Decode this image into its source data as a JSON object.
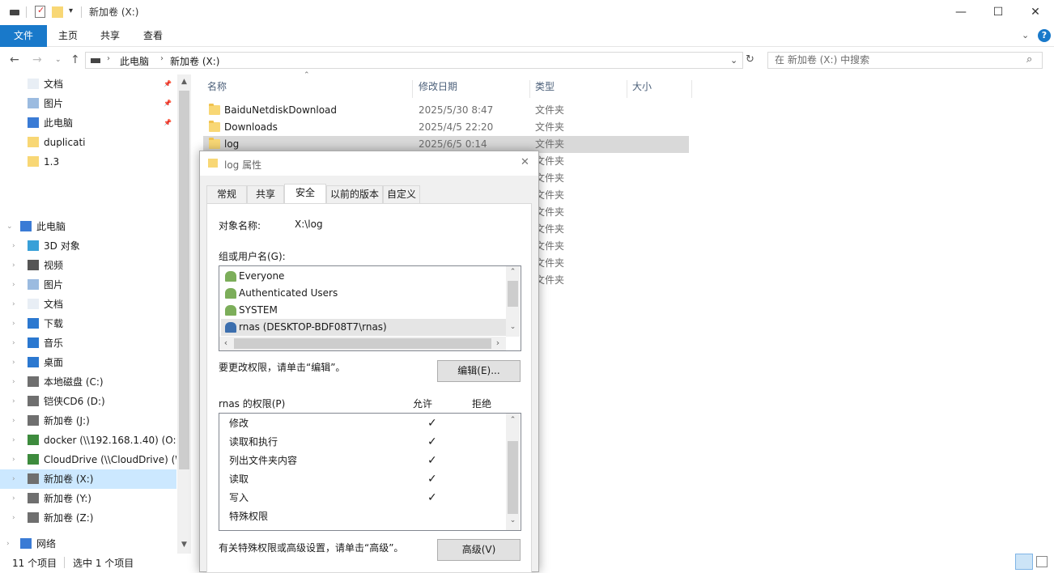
{
  "window": {
    "title": "新加卷 (X:)",
    "minimize": "—",
    "maximize": "☐",
    "close": "✕"
  },
  "ribbon": {
    "tabs": [
      "文件",
      "主页",
      "共享",
      "查看"
    ],
    "help": "?"
  },
  "address": {
    "crumbs": [
      "此电脑",
      "新加卷 (X:)"
    ],
    "search_placeholder": "在 新加卷 (X:) 中搜索"
  },
  "nav": {
    "quick": [
      {
        "label": "文档",
        "icon": "document-icon",
        "pinned": true
      },
      {
        "label": "图片",
        "icon": "picture-icon",
        "pinned": true
      },
      {
        "label": "此电脑",
        "icon": "computer-icon",
        "pinned": true
      },
      {
        "label": "duplicati",
        "icon": "folder-icon",
        "pinned": false
      },
      {
        "label": "1.3",
        "icon": "folder-icon",
        "pinned": false
      }
    ],
    "this_pc": "此电脑",
    "pc_items": [
      {
        "label": "3D 对象",
        "icon": "cube-icon"
      },
      {
        "label": "视频",
        "icon": "video-icon"
      },
      {
        "label": "图片",
        "icon": "picture-icon"
      },
      {
        "label": "文档",
        "icon": "document-icon"
      },
      {
        "label": "下载",
        "icon": "download-icon"
      },
      {
        "label": "音乐",
        "icon": "music-icon"
      },
      {
        "label": "桌面",
        "icon": "desktop-icon"
      },
      {
        "label": "本地磁盘 (C:)",
        "icon": "drive-icon"
      },
      {
        "label": "铠侠CD6 (D:)",
        "icon": "drive-icon"
      },
      {
        "label": "新加卷 (J:)",
        "icon": "drive-icon"
      },
      {
        "label": "docker (\\\\192.168.1.40) (O:)",
        "icon": "network-drive-icon"
      },
      {
        "label": "CloudDrive (\\\\CloudDrive) (W",
        "icon": "network-drive-icon"
      },
      {
        "label": "新加卷 (X:)",
        "icon": "drive-icon",
        "selected": true
      },
      {
        "label": "新加卷 (Y:)",
        "icon": "drive-icon"
      },
      {
        "label": "新加卷 (Z:)",
        "icon": "drive-icon"
      }
    ],
    "network": "网络"
  },
  "columns": {
    "name": "名称",
    "date": "修改日期",
    "type": "类型",
    "size": "大小"
  },
  "files": [
    {
      "name": "BaiduNetdiskDownload",
      "date": "2025/5/30 8:47",
      "type": "文件夹"
    },
    {
      "name": "Downloads",
      "date": "2025/4/5 22:20",
      "type": "文件夹"
    },
    {
      "name": "log",
      "date": "2025/6/5 0:14",
      "type": "文件夹",
      "selected": true
    }
  ],
  "hidden_types": [
    "文件夹",
    "文件夹",
    "文件夹",
    "文件夹",
    "文件夹",
    "文件夹",
    "文件夹",
    "文件夹"
  ],
  "status": {
    "count": "11 个项目",
    "selected": "选中 1 个项目"
  },
  "dialog": {
    "title": "log 属性",
    "tabs": [
      "常规",
      "共享",
      "安全",
      "以前的版本",
      "自定义"
    ],
    "object_label": "对象名称:",
    "object_value": "X:\\log",
    "group_label": "组或用户名(G):",
    "users": [
      {
        "name": "Everyone",
        "icon": "users-group-icon"
      },
      {
        "name": "Authenticated Users",
        "icon": "users-group-icon"
      },
      {
        "name": "SYSTEM",
        "icon": "users-group-icon"
      },
      {
        "name": "rnas (DESKTOP-BDF08T7\\rnas)",
        "icon": "user-icon",
        "selected": true
      }
    ],
    "edit_hint": "要更改权限，请单击“编辑”。",
    "edit_button": "编辑(E)...",
    "perm_title": "rnas 的权限(P)",
    "allow": "允许",
    "deny": "拒绝",
    "permissions": [
      {
        "name": "修改",
        "allow": "✓"
      },
      {
        "name": "读取和执行",
        "allow": "✓"
      },
      {
        "name": "列出文件夹内容",
        "allow": "✓"
      },
      {
        "name": "读取",
        "allow": "✓"
      },
      {
        "name": "写入",
        "allow": "✓"
      },
      {
        "name": "特殊权限",
        "allow": ""
      }
    ],
    "advanced_hint": "有关特殊权限或高级设置，请单击“高级”。",
    "advanced_button": "高级(V)"
  }
}
